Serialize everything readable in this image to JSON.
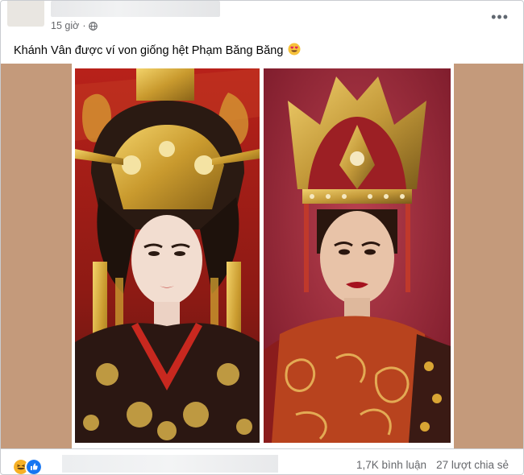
{
  "post": {
    "time": "15 giờ",
    "caption": "Khánh Vân được ví von giống hệt Phạm Băng  Băng",
    "more_label": "•••"
  },
  "footer": {
    "comments": "1,7K bình luận",
    "shares": "27 lượt chia sẻ"
  },
  "colors": {
    "media_background": "#c49a7b",
    "like_blue": "#1877f2",
    "haha_yellow": "#f7b125"
  },
  "icons": {
    "privacy": "globe-icon",
    "emoji": "heart-eyes-emoji-icon",
    "reactions": [
      "haha-reaction-icon",
      "like-reaction-icon"
    ]
  }
}
